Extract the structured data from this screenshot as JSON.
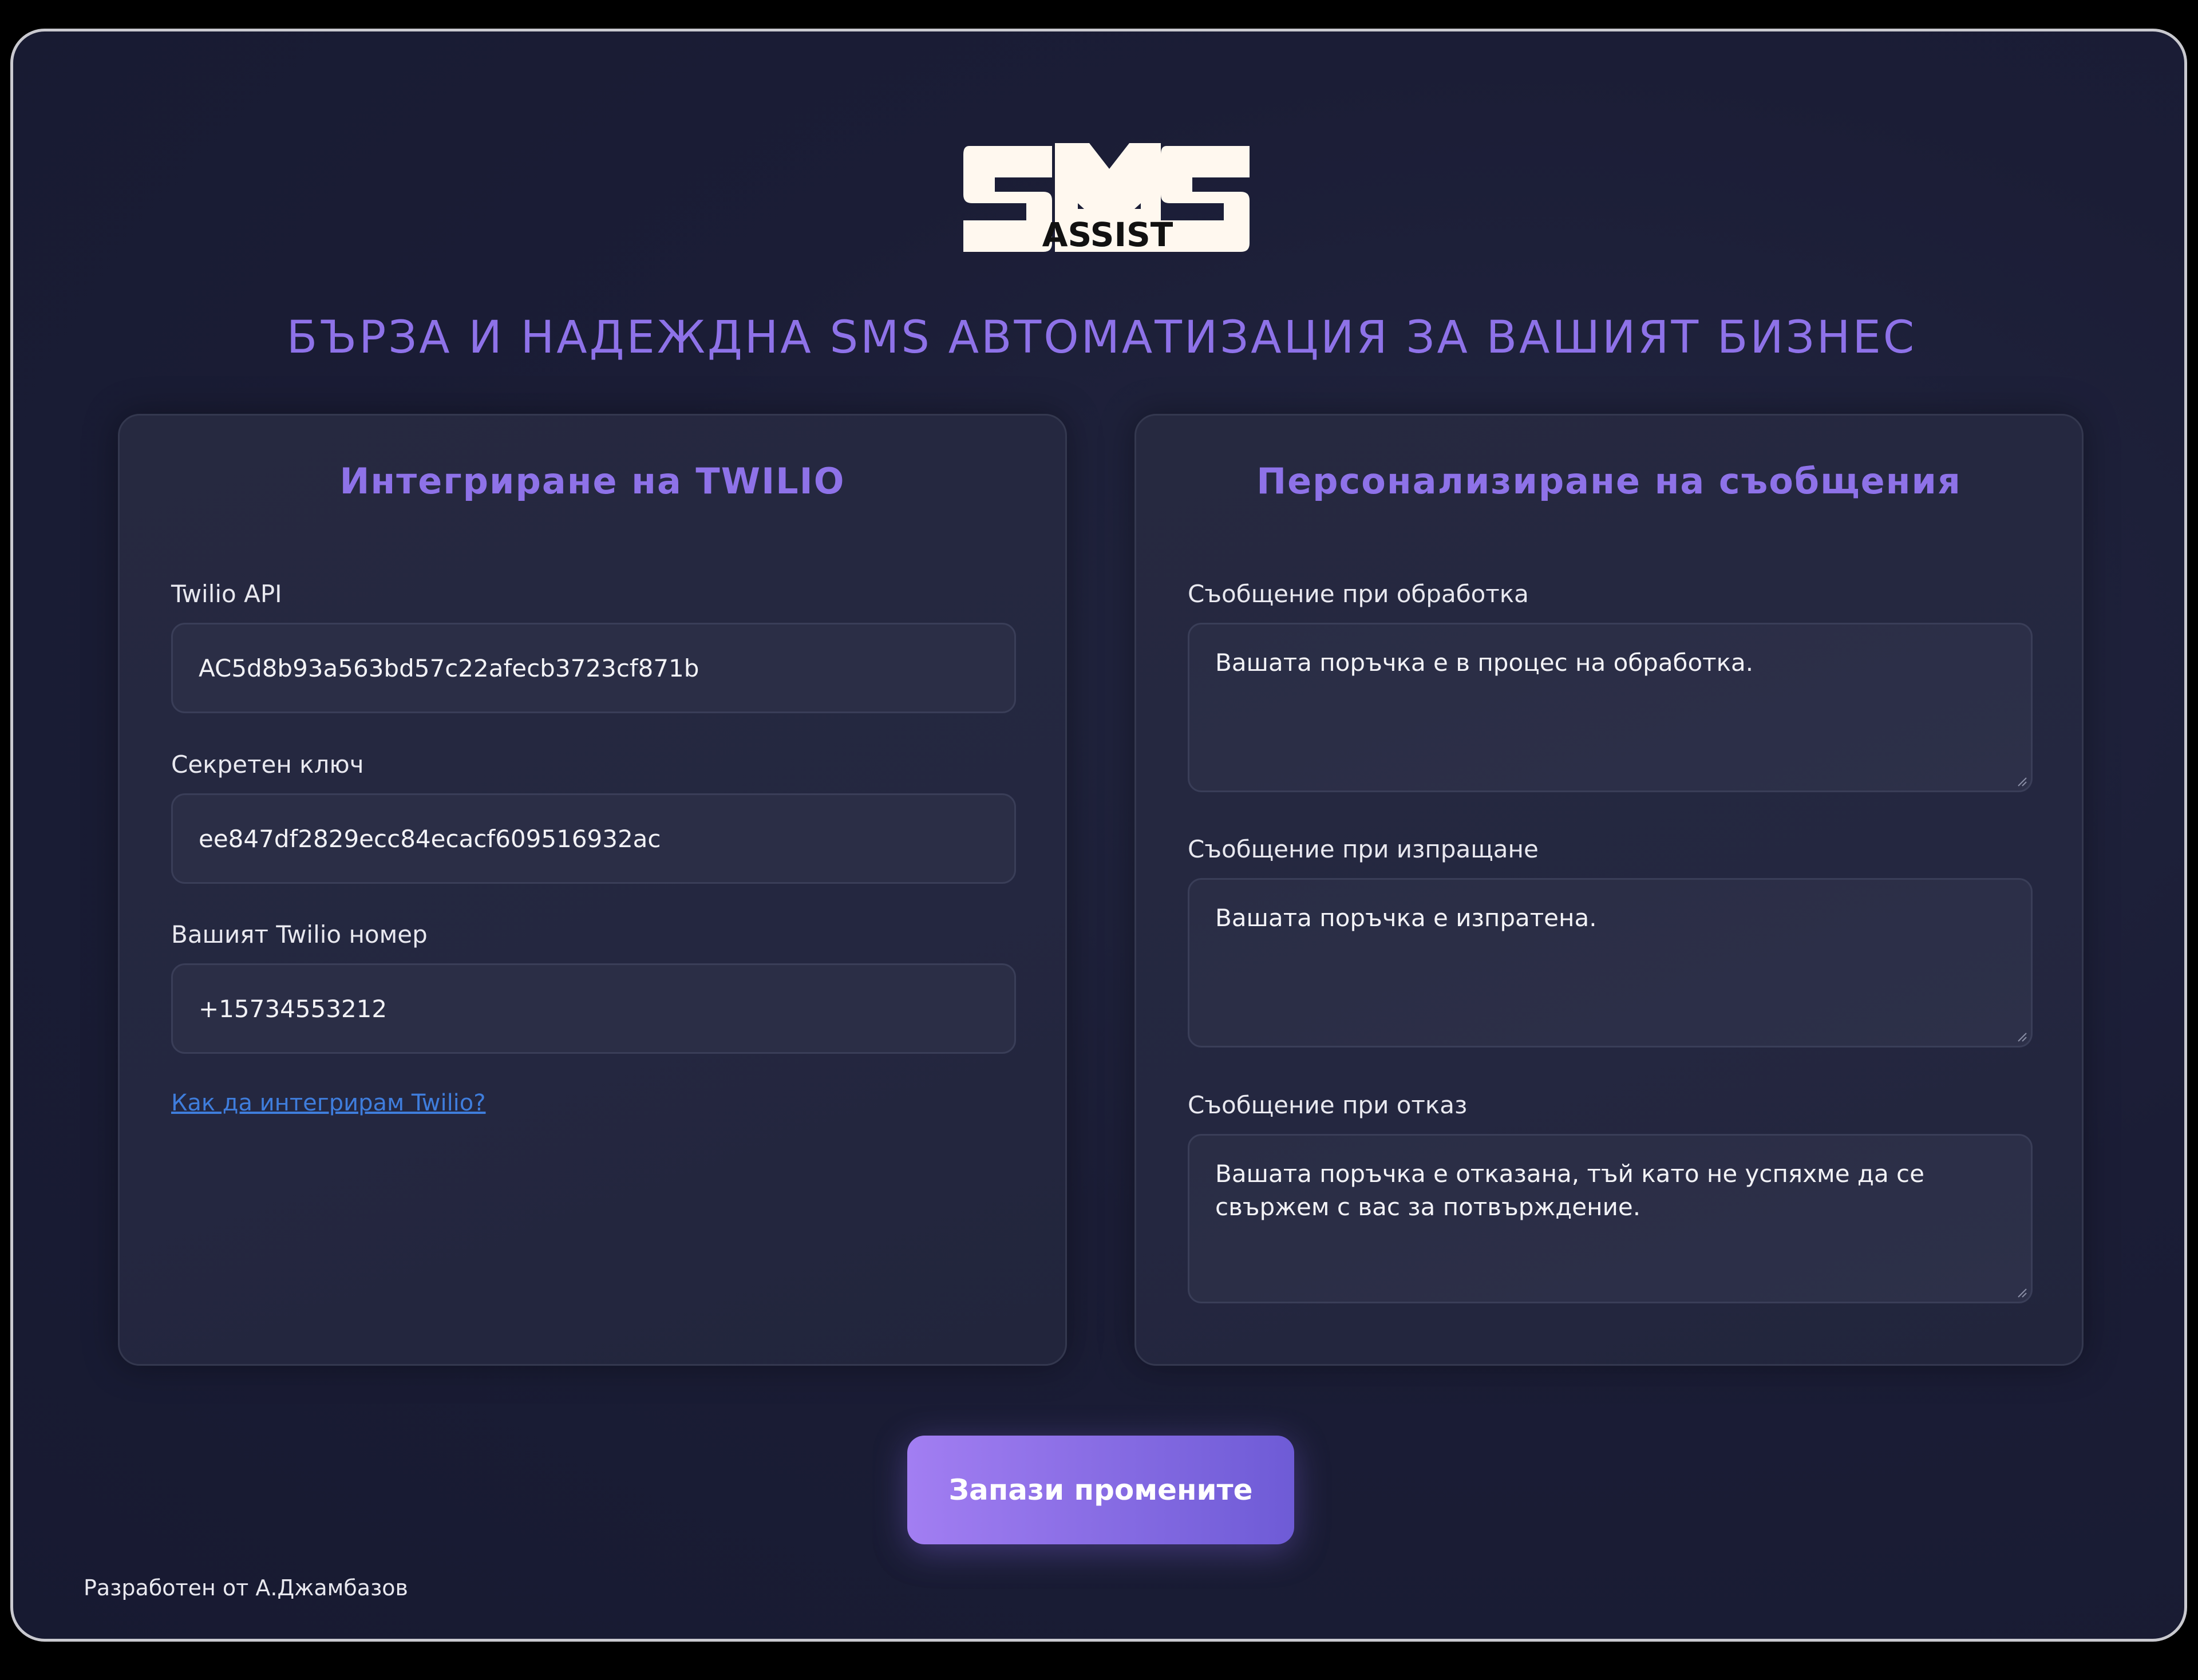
{
  "logo": {
    "text": "SMS",
    "subtext": "ASSIST"
  },
  "headline": "БЪРЗА И НАДЕЖДНА SMS АВТОМАТИЗАЦИЯ ЗА ВАШИЯТ БИЗНЕС",
  "twilio_card": {
    "title": "Интегриране на TWILIO",
    "fields": [
      {
        "label": "Twilio API",
        "value": "AC5d8b93a563bd57c22afecb3723cf871b"
      },
      {
        "label": "Секретен ключ",
        "value": "ee847df2829ecc84ecacf609516932ac"
      },
      {
        "label": "Вашият Twilio номер",
        "value": "+15734553212"
      }
    ],
    "help_link": "Как да интегрирам Twilio?"
  },
  "messages_card": {
    "title": "Персонализиране на съобщения",
    "fields": [
      {
        "label": "Съобщение при обработка",
        "value": "Вашата поръчка е в процес на обработка."
      },
      {
        "label": "Съобщение при изпращане",
        "value": "Вашата поръчка е изпратена."
      },
      {
        "label": "Съобщение при отказ",
        "value": "Вашата поръчка е отказана, тъй като не успяхме да се свържем с вас за потвърждение."
      }
    ]
  },
  "save_button": "Запази промените",
  "footer": "Разработен от А.Джамбазов",
  "colors": {
    "accent": "#8e72e8",
    "link": "#3f7ddc",
    "background": "#1b1d36",
    "card": "#252840",
    "input": "#2b2e46"
  }
}
